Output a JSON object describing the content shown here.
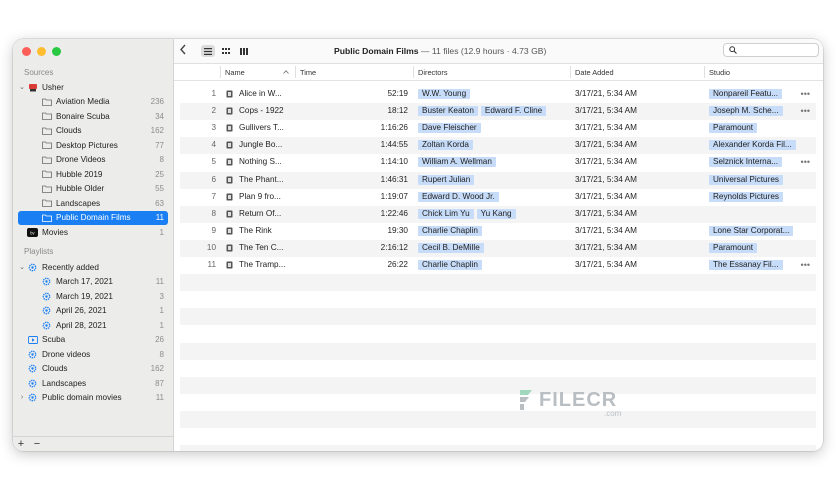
{
  "colors": {
    "accent": "#1a7ff2",
    "tag": "#c7dcf8",
    "close": "#fe5f57",
    "minimize": "#febc2e",
    "zoom": "#28c840"
  },
  "sidebar": {
    "sources_label": "Sources",
    "playlists_label": "Playlists",
    "sources": [
      {
        "label": "Usher",
        "count": "",
        "icon": "drive-icon",
        "level": 0,
        "disclosure": "⌄"
      },
      {
        "label": "Aviation Media",
        "count": "236",
        "icon": "folder-icon",
        "level": 1
      },
      {
        "label": "Bonaire Scuba",
        "count": "34",
        "icon": "folder-icon",
        "level": 1
      },
      {
        "label": "Clouds",
        "count": "162",
        "icon": "folder-icon",
        "level": 1
      },
      {
        "label": "Desktop Pictures",
        "count": "77",
        "icon": "folder-icon",
        "level": 1
      },
      {
        "label": "Drone Videos",
        "count": "8",
        "icon": "folder-icon",
        "level": 1
      },
      {
        "label": "Hubble 2019",
        "count": "25",
        "icon": "folder-icon",
        "level": 1
      },
      {
        "label": "Hubble Older",
        "count": "55",
        "icon": "folder-icon",
        "level": 1
      },
      {
        "label": "Landscapes",
        "count": "63",
        "icon": "folder-icon",
        "level": 1
      },
      {
        "label": "Public Domain Films",
        "count": "11",
        "icon": "folder-icon",
        "level": 1,
        "selected": true
      },
      {
        "label": "Movies",
        "count": "1",
        "icon": "tv-icon",
        "level": 0
      }
    ],
    "playlists": [
      {
        "label": "Recently added",
        "count": "",
        "icon": "smart-playlist-icon",
        "level": 0,
        "disclosure": "⌄"
      },
      {
        "label": "March 17, 2021",
        "count": "11",
        "icon": "smart-playlist-icon",
        "level": 1
      },
      {
        "label": "March 19, 2021",
        "count": "3",
        "icon": "smart-playlist-icon",
        "level": 1
      },
      {
        "label": "April 26, 2021",
        "count": "1",
        "icon": "smart-playlist-icon",
        "level": 1
      },
      {
        "label": "April 28, 2021",
        "count": "1",
        "icon": "smart-playlist-icon",
        "level": 1
      },
      {
        "label": "Scuba",
        "count": "26",
        "icon": "playlist-icon",
        "level": 0
      },
      {
        "label": "Drone videos",
        "count": "8",
        "icon": "smart-playlist-icon",
        "level": 0
      },
      {
        "label": "Clouds",
        "count": "162",
        "icon": "smart-playlist-icon",
        "level": 0
      },
      {
        "label": "Landscapes",
        "count": "87",
        "icon": "smart-playlist-icon",
        "level": 0
      },
      {
        "label": "Public domain movies",
        "count": "11",
        "icon": "smart-playlist-icon",
        "level": 0,
        "disclosure": "›"
      }
    ],
    "add_label": "+",
    "remove_label": "−"
  },
  "toolbar": {
    "title": "Public Domain Films",
    "subtitle": " — 11 files (12.9 hours · 4.73 GB)",
    "view_modes": [
      "list-view-icon",
      "grid-view-icon",
      "column-view-icon"
    ]
  },
  "columns": [
    "Name",
    "Time",
    "Directors",
    "Date Added",
    "Studio"
  ],
  "rows": [
    {
      "n": "1",
      "name": "Alice in W...",
      "time": "52:19",
      "directors": [
        "W.W. Young"
      ],
      "date": "3/17/21, 5:34 AM",
      "studio": "Nonpareil Featu...",
      "more": true
    },
    {
      "n": "2",
      "name": "Cops - 1922",
      "time": "18:12",
      "directors": [
        "Buster Keaton",
        "Edward F. Cline"
      ],
      "date": "3/17/21, 5:34 AM",
      "studio": "Joseph M. Sche...",
      "more": true
    },
    {
      "n": "3",
      "name": "Gullivers T...",
      "time": "1:16:26",
      "directors": [
        "Dave Fleischer"
      ],
      "date": "3/17/21, 5:34 AM",
      "studio": "Paramount",
      "more": false
    },
    {
      "n": "4",
      "name": "Jungle Bo...",
      "time": "1:44:55",
      "directors": [
        "Zoltan Korda"
      ],
      "date": "3/17/21, 5:34 AM",
      "studio": "Alexander Korda Fil...",
      "more": false
    },
    {
      "n": "5",
      "name": "Nothing S...",
      "time": "1:14:10",
      "directors": [
        "William A. Wellman"
      ],
      "date": "3/17/21, 5:34 AM",
      "studio": "Selznick Interna...",
      "more": true
    },
    {
      "n": "6",
      "name": "The Phant...",
      "time": "1:46:31",
      "directors": [
        "Rupert Julian"
      ],
      "date": "3/17/21, 5:34 AM",
      "studio": "Universal Pictures",
      "more": false
    },
    {
      "n": "7",
      "name": "Plan 9 fro...",
      "time": "1:19:07",
      "directors": [
        "Edward D. Wood Jr."
      ],
      "date": "3/17/21, 5:34 AM",
      "studio": "Reynolds Pictures",
      "more": false
    },
    {
      "n": "8",
      "name": "Return Of...",
      "time": "1:22:46",
      "directors": [
        "Chick Lim Yu",
        "Yu Kang"
      ],
      "date": "3/17/21, 5:34 AM",
      "studio": "",
      "more": false
    },
    {
      "n": "9",
      "name": "The Rink",
      "time": "19:30",
      "directors": [
        "Charlie Chaplin"
      ],
      "date": "3/17/21, 5:34 AM",
      "studio": "Lone Star Corporat...",
      "more": false
    },
    {
      "n": "10",
      "name": "The Ten C...",
      "time": "2:16:12",
      "directors": [
        "Cecil B. DeMille"
      ],
      "date": "3/17/21, 5:34 AM",
      "studio": "Paramount",
      "more": false
    },
    {
      "n": "11",
      "name": "The Tramp...",
      "time": "26:22",
      "directors": [
        "Charlie Chaplin"
      ],
      "date": "3/17/21, 5:34 AM",
      "studio": "The Essanay Fil...",
      "more": true
    }
  ],
  "watermark": {
    "text": "FILECR",
    "suffix": ".com"
  }
}
